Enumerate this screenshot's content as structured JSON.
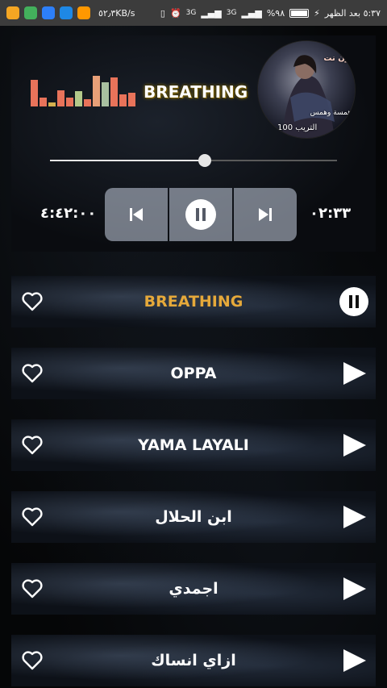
{
  "status_bar": {
    "speed": "٥٢٫٣KB/s",
    "time": "٥:٣٧ بعد الظهر",
    "battery": "%٩٨",
    "network": "3G",
    "network2": "3G",
    "battery_level": 0.98,
    "app_icon_colors": [
      "#f5a623",
      "#4caf50",
      "#2196f3",
      "#1e88e5",
      "#ff9800"
    ]
  },
  "player": {
    "title": "BREATHING",
    "elapsed": "٠٢:٣٣",
    "duration": "٤:٤٢:٠٠",
    "progress": 0.54,
    "cover_text": {
      "top": "ون نت",
      "middle": "همسة وهمس",
      "bottom": "التريب 100"
    },
    "equalizer_levels": [
      0.82,
      0.28,
      0.12,
      0.5,
      0.28,
      0.48,
      0.22,
      0.95,
      0.75,
      0.9,
      0.38,
      0.42
    ],
    "equalizer_colors": [
      "#e8735a",
      "#e8735a",
      "#d5b04e",
      "#e8735a",
      "#e8735a",
      "#b4c98a",
      "#e8735a",
      "#e8a078",
      "#a8c0a0",
      "#e8735a",
      "#e8735a",
      "#e8735a"
    ]
  },
  "tracks": [
    {
      "title": "BREATHING",
      "active": true
    },
    {
      "title": "OPPA",
      "active": false
    },
    {
      "title": "YAMA LAYALI",
      "active": false
    },
    {
      "title": "ابن الحلال",
      "active": false
    },
    {
      "title": "اجمدي",
      "active": false
    },
    {
      "title": "ازاي انساك",
      "active": false
    }
  ],
  "colors": {
    "active_track": "#e6a93a",
    "status_bar": "#3c3c3c"
  }
}
